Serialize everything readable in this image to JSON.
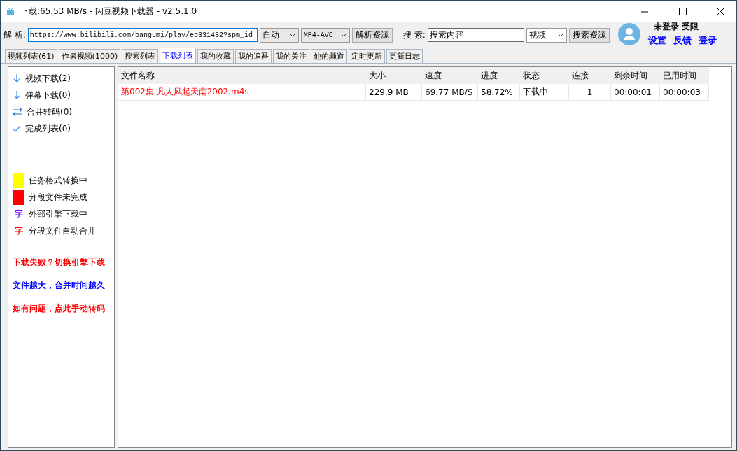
{
  "window": {
    "title": "下载:65.53 MB/s - 闪豆视频下载器 - v2.5.1.0"
  },
  "toolbar": {
    "parse_label": "解 析:",
    "url": "https://www.bilibili.com/bangumi/play/ep331432?spm_id",
    "quality": "自动",
    "format": "MP4-AVC",
    "parse_button": "解析资源",
    "search_label": "搜 索:",
    "search_value": "搜索内容",
    "search_type": "视频",
    "search_button": "搜索资源"
  },
  "account": {
    "status": "未登录 受限",
    "links": [
      "设置",
      "反馈",
      "登录"
    ]
  },
  "tabs": [
    {
      "label": "视频列表(61)",
      "selected": false
    },
    {
      "label": "作者视频(1000)",
      "selected": false
    },
    {
      "label": "搜索列表",
      "selected": false
    },
    {
      "label": "下载列表",
      "selected": true
    },
    {
      "label": "我的收藏",
      "selected": false
    },
    {
      "label": "我的追番",
      "selected": false
    },
    {
      "label": "我的关注",
      "selected": false
    },
    {
      "label": "他的频道",
      "selected": false
    },
    {
      "label": "定时更新",
      "selected": false
    },
    {
      "label": "更新日志",
      "selected": false
    }
  ],
  "sidebar": {
    "items": [
      {
        "kind": "down",
        "label": "视频下载(2)"
      },
      {
        "kind": "down",
        "label": "弹幕下载(0)"
      },
      {
        "kind": "merge",
        "label": "合并转码(0)"
      },
      {
        "kind": "check",
        "label": "完成列表(0)"
      }
    ],
    "legend": [
      {
        "kind": "swatch",
        "color": "#ffff00",
        "label": "任务格式转换中"
      },
      {
        "kind": "swatch",
        "color": "#ff0000",
        "label": "分段文件未完成"
      },
      {
        "kind": "glyph",
        "glyph": "字",
        "color": "#8000ff",
        "label": "外部引擎下载中"
      },
      {
        "kind": "glyph",
        "glyph": "字",
        "color": "#ff0000",
        "label": "分段文件自动合并"
      }
    ],
    "notes": [
      {
        "text": "下载失败？切换引擎下载",
        "color": "#ff0000"
      },
      {
        "text": "文件越大，合并时间越久",
        "color": "#0000ff"
      },
      {
        "text": "如有问题，点此手动转码",
        "color": "#ff0000"
      }
    ]
  },
  "table": {
    "columns": [
      "文件名称",
      "大小",
      "速度",
      "进度",
      "状态",
      "连接",
      "剩余时间",
      "已用时间"
    ],
    "rows": [
      {
        "cells": [
          "第002集 凡人风起天南2002.m4s",
          "229.9 MB",
          "69.77 MB/S",
          "58.72%",
          "下载中",
          "1",
          "00:00:01",
          "00:00:03"
        ],
        "color": "#ff0000"
      }
    ]
  }
}
